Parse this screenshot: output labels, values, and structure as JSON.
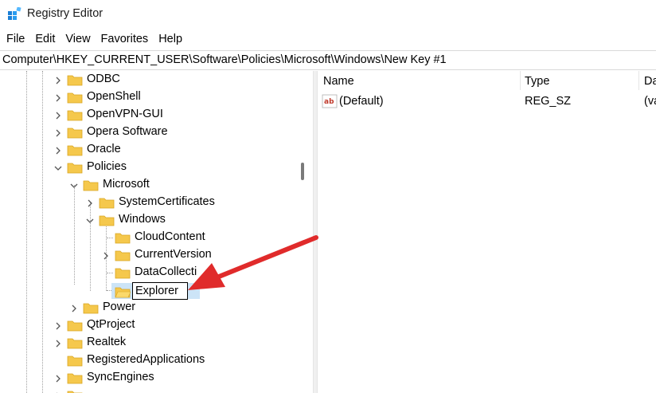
{
  "window": {
    "title": "Registry Editor"
  },
  "menu": [
    "File",
    "Edit",
    "View",
    "Favorites",
    "Help"
  ],
  "address": "Computer\\HKEY_CURRENT_USER\\Software\\Policies\\Microsoft\\Windows\\New Key #1",
  "tree": {
    "odbc": "ODBC",
    "openshell": "OpenShell",
    "openvpn": "OpenVPN-GUI",
    "opera": "Opera Software",
    "oracle": "Oracle",
    "policies": "Policies",
    "microsoft": "Microsoft",
    "systemcertificates": "SystemCertificates",
    "windows": "Windows",
    "cloudcontent": "CloudContent",
    "currentversion": "CurrentVersion",
    "datacollection": "DataCollecti",
    "explorer": "Explorer",
    "power": "Power",
    "qtproject": "QtProject",
    "realtek": "Realtek",
    "registeredapplications": "RegisteredApplications",
    "syncengines": "SyncEngines"
  },
  "list": {
    "columns": {
      "name": "Name",
      "type": "Type",
      "data": "Da"
    },
    "rows": [
      {
        "name": "(Default)",
        "type": "REG_SZ",
        "data": "(va"
      }
    ]
  },
  "colors": {
    "folder": "#f5c84c",
    "selection": "#cce4f7",
    "arrow": "#e02b2b"
  }
}
